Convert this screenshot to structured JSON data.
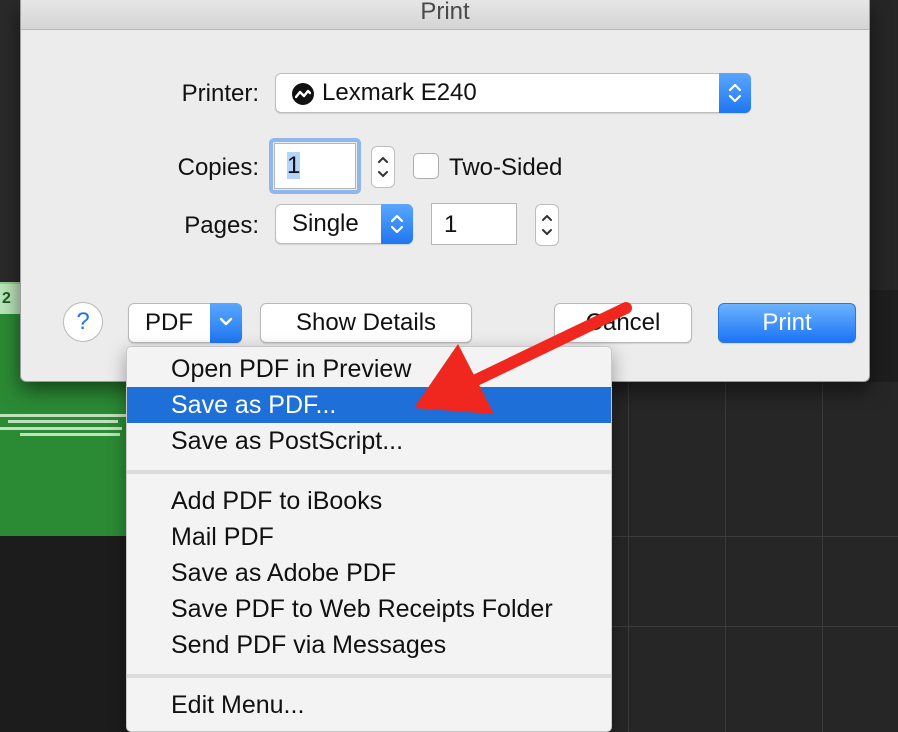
{
  "dialog": {
    "title": "Print",
    "printer_label": "Printer:",
    "printer_value": "Lexmark E240",
    "copies_label": "Copies:",
    "copies_value": "1",
    "two_sided_label": "Two-Sided",
    "pages_label": "Pages:",
    "pages_mode": "Single",
    "pages_value": "1",
    "help_label": "?",
    "pdf_label": "PDF",
    "show_details_label": "Show Details",
    "cancel_label": "Cancel",
    "print_label": "Print"
  },
  "pdf_menu": {
    "group1": [
      "Open PDF in Preview",
      "Save as PDF...",
      "Save as PostScript..."
    ],
    "selected": "Save as PDF...",
    "group2": [
      "Add PDF to iBooks",
      "Mail PDF",
      "Save as Adobe PDF",
      "Save PDF to Web Receipts Folder",
      "Send PDF via Messages"
    ],
    "group3": [
      "Edit Menu..."
    ]
  },
  "background": {
    "track_label": "2"
  },
  "colors": {
    "accent": "#1f76f0",
    "menu_highlight": "#1f6fd8",
    "annotation_arrow": "#f0271f",
    "track_green": "#2b8a34"
  },
  "icons": {
    "printer": "printer-status-icon",
    "popup": "chevron-up-down-icon",
    "pdf": "chevron-down-icon",
    "annotation": "red-arrow-icon"
  }
}
